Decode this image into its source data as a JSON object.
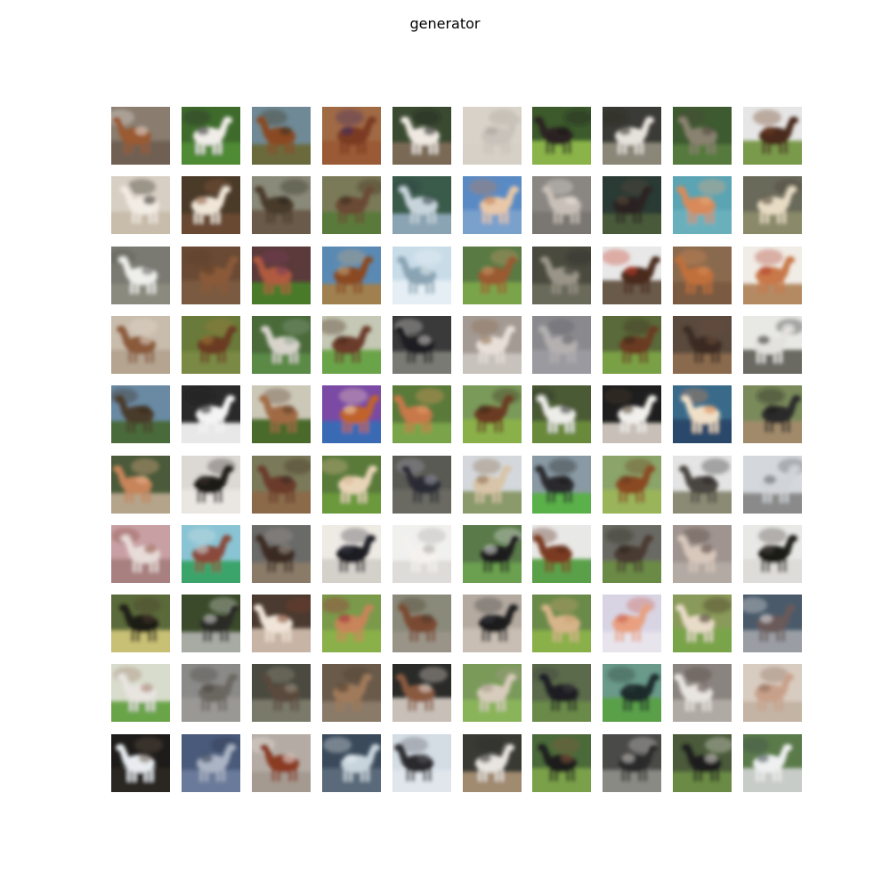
{
  "title": "generator",
  "grid": {
    "rows": 10,
    "cols": 10,
    "subject": "horse"
  },
  "tiles": [
    {
      "bg": "#8a7d70",
      "ground": "#6f6153",
      "body": "#9a5a32",
      "accent": "#e8e2da"
    },
    {
      "bg": "#3e6b2c",
      "ground": "#4f8a34",
      "body": "#f0ede8",
      "accent": "#2a2a2a"
    },
    {
      "bg": "#6f8a96",
      "ground": "#6b6a3c",
      "body": "#8a4a24",
      "accent": "#3c3023"
    },
    {
      "bg": "#a06a45",
      "ground": "#9a5a35",
      "body": "#7a3a20",
      "accent": "#3a2a66"
    },
    {
      "bg": "#3a4a30",
      "ground": "#7a6a55",
      "body": "#efe9e2",
      "accent": "#1c1c1c"
    },
    {
      "bg": "#d8d2c8",
      "ground": "#d6d0c6",
      "body": "#c8c2ba",
      "accent": "#a8a29a"
    },
    {
      "bg": "#3c5a2c",
      "ground": "#8ab44a",
      "body": "#2a2420",
      "accent": "#1a1a1a"
    },
    {
      "bg": "#3a3a36",
      "ground": "#8a8678",
      "body": "#e6e2dc",
      "accent": "#2a2622"
    },
    {
      "bg": "#3e5a30",
      "ground": "#567a3c",
      "body": "#8a8270",
      "accent": "#4a463c"
    },
    {
      "bg": "#e6e6e6",
      "ground": "#7a9a4c",
      "body": "#4a2a1a",
      "accent": "#6a3a20"
    },
    {
      "bg": "#d8cfc4",
      "ground": "#c8bcaa",
      "body": "#f2ece4",
      "accent": "#2a2420"
    },
    {
      "bg": "#4a3a28",
      "ground": "#6a4a30",
      "body": "#f0e6d8",
      "accent": "#8a5a3a"
    },
    {
      "bg": "#8a8a7a",
      "ground": "#6a5a4a",
      "body": "#4a3a2c",
      "accent": "#2a241e"
    },
    {
      "bg": "#7a7a58",
      "ground": "#5a7a3a",
      "body": "#6a4a34",
      "accent": "#3a2a1e"
    },
    {
      "bg": "#3a5a4a",
      "ground": "#8aa4b4",
      "body": "#c8d4dc",
      "accent": "#2a3a44"
    },
    {
      "bg": "#5a8ac4",
      "ground": "#7aa0cc",
      "body": "#e8c8a8",
      "accent": "#c07a50"
    },
    {
      "bg": "#8a8682",
      "ground": "#7a7672",
      "body": "#c8c0b8",
      "accent": "#e8e2dc"
    },
    {
      "bg": "#2a3a34",
      "ground": "#4a5a3a",
      "body": "#2a2420",
      "accent": "#5a4a3a"
    },
    {
      "bg": "#5aa4b4",
      "ground": "#6ab0bc",
      "body": "#d88a5a",
      "accent": "#e8a878"
    },
    {
      "bg": "#6a6a5a",
      "ground": "#8a8a6a",
      "body": "#e8dcc4",
      "accent": "#4a3e30"
    },
    {
      "bg": "#7a7a72",
      "ground": "#8a8a7e",
      "body": "#eeeeea",
      "accent": "#5a5a56"
    },
    {
      "bg": "#6a4a34",
      "ground": "#7a5a40",
      "body": "#8a5a38",
      "accent": "#5a3a24"
    },
    {
      "bg": "#5a3a3a",
      "ground": "#4a7a2c",
      "body": "#b05a40",
      "accent": "#7a3a5a"
    },
    {
      "bg": "#5a8ab4",
      "ground": "#a08050",
      "body": "#8a4a24",
      "accent": "#c8a87a"
    },
    {
      "bg": "#c8dce8",
      "ground": "#e4eef4",
      "body": "#8aa4b4",
      "accent": "#eaf2f6"
    },
    {
      "bg": "#5a7a44",
      "ground": "#7aa448",
      "body": "#9a5a30",
      "accent": "#c89a6a"
    },
    {
      "bg": "#4a4a3e",
      "ground": "#6a6a5a",
      "body": "#9a9488",
      "accent": "#2a2a24"
    },
    {
      "bg": "#e8e8e8",
      "ground": "#6a5a4a",
      "body": "#4a2a1e",
      "accent": "#c83a2a"
    },
    {
      "bg": "#8a6a4e",
      "ground": "#7a5a40",
      "body": "#c0703a",
      "accent": "#d88a54"
    },
    {
      "bg": "#f0ece6",
      "ground": "#b48a64",
      "body": "#c8784a",
      "accent": "#b03a2a"
    },
    {
      "bg": "#c8bcac",
      "ground": "#b4a490",
      "body": "#8a5a3a",
      "accent": "#e8ddd0"
    },
    {
      "bg": "#6a7a3a",
      "ground": "#7a8a44",
      "body": "#6a3a20",
      "accent": "#a07a3a"
    },
    {
      "bg": "#4a6a3a",
      "ground": "#5a8a44",
      "body": "#d8d4cc",
      "accent": "#8aa08a"
    },
    {
      "bg": "#c4c8b4",
      "ground": "#6aa44a",
      "body": "#6a3a2a",
      "accent": "#4a2a1e"
    },
    {
      "bg": "#3a3a3a",
      "ground": "#7a7a74",
      "body": "#1e1e22",
      "accent": "#d8d4d0"
    },
    {
      "bg": "#a49a94",
      "ground": "#c8c2bc",
      "body": "#e8e0d8",
      "accent": "#8a6a4a"
    },
    {
      "bg": "#8a8a8e",
      "ground": "#9a9aa0",
      "body": "#b4b0b0",
      "accent": "#5a5a60"
    },
    {
      "bg": "#5a6a3a",
      "ground": "#7aa044",
      "body": "#6a3a20",
      "accent": "#3a2a1a"
    },
    {
      "bg": "#5a4a3e",
      "ground": "#8a6a4e",
      "body": "#3a2a22",
      "accent": "#6a4a3a"
    },
    {
      "bg": "#e8e8e4",
      "ground": "#6a6a64",
      "body": "#e4e2de",
      "accent": "#2a2a28"
    },
    {
      "bg": "#6a8aa4",
      "ground": "#4a6a3a",
      "body": "#4a3a2a",
      "accent": "#3a2a1e"
    },
    {
      "bg": "#2a2a2a",
      "ground": "#e8e8e8",
      "body": "#f4f4f4",
      "accent": "#1a1a1a"
    },
    {
      "bg": "#ccc8b8",
      "ground": "#4a6a2a",
      "body": "#a06a44",
      "accent": "#5a3a24"
    },
    {
      "bg": "#7a4aa4",
      "ground": "#3a6ab4",
      "body": "#c0642a",
      "accent": "#f0d8c0"
    },
    {
      "bg": "#5a7a3a",
      "ground": "#7aa448",
      "body": "#c8784a",
      "accent": "#e49a64"
    },
    {
      "bg": "#7a9a5a",
      "ground": "#8ab04a",
      "body": "#6a3a20",
      "accent": "#3a2a1a"
    },
    {
      "bg": "#4a5a34",
      "ground": "#6a8a3a",
      "body": "#ecece8",
      "accent": "#2a2a24"
    },
    {
      "bg": "#1e1e1e",
      "ground": "#c8c0b8",
      "body": "#f2f0ec",
      "accent": "#4a3a2a"
    },
    {
      "bg": "#3a6a8a",
      "ground": "#2a4a6a",
      "body": "#f0e0c8",
      "accent": "#d8844a"
    },
    {
      "bg": "#7a8a5a",
      "ground": "#a08a6a",
      "body": "#2a2a2a",
      "accent": "#1a1a1a"
    },
    {
      "bg": "#4a5a3a",
      "ground": "#b4a48a",
      "body": "#c8845a",
      "accent": "#e8b08a"
    },
    {
      "bg": "#dcd8d4",
      "ground": "#eae6e2",
      "body": "#1e1a18",
      "accent": "#3a3430"
    },
    {
      "bg": "#7a7a5a",
      "ground": "#8a6a4a",
      "body": "#6a3a2a",
      "accent": "#3a2a22"
    },
    {
      "bg": "#5a7a3a",
      "ground": "#6a9a3a",
      "body": "#e8d4b8",
      "accent": "#d8b490"
    },
    {
      "bg": "#5a5a54",
      "ground": "#6a6a64",
      "body": "#2a2a34",
      "accent": "#a4a4b4"
    },
    {
      "bg": "#d4d8dc",
      "ground": "#8a9a6a",
      "body": "#d8c4a8",
      "accent": "#8a6a4a"
    },
    {
      "bg": "#8a9aa4",
      "ground": "#5ab04a",
      "body": "#2a2a2e",
      "accent": "#1a1a1a"
    },
    {
      "bg": "#8aa46a",
      "ground": "#9ab45a",
      "body": "#8a4a24",
      "accent": "#6a3a20"
    },
    {
      "bg": "#e4e4e4",
      "ground": "#8a8a74",
      "body": "#4a4440",
      "accent": "#2a2624"
    },
    {
      "bg": "#d4d8dc",
      "ground": "#8a8a8a",
      "body": "#d0d4d8",
      "accent": "#5a5e64"
    },
    {
      "bg": "#c8a0a4",
      "ground": "#a88080",
      "body": "#e8dcd8",
      "accent": "#8a4a3a"
    },
    {
      "bg": "#8ac4d4",
      "ground": "#3aa46a",
      "body": "#8a4a3a",
      "accent": "#d4e0e4"
    },
    {
      "bg": "#6a6a68",
      "ground": "#8a7a68",
      "body": "#3a2a22",
      "accent": "#a49c94"
    },
    {
      "bg": "#eeeae4",
      "ground": "#d4d0ca",
      "body": "#1a1a24",
      "accent": "#3a3a44"
    },
    {
      "bg": "#f0f0ee",
      "ground": "#dedcd8",
      "body": "#f4f2ee",
      "accent": "#aaa6a0"
    },
    {
      "bg": "#5a7a4a",
      "ground": "#6aa050",
      "body": "#1e1e1e",
      "accent": "#ececec"
    },
    {
      "bg": "#e8e8e6",
      "ground": "#5aa04a",
      "body": "#7a3a20",
      "accent": "#5a2a18"
    },
    {
      "bg": "#6a6a64",
      "ground": "#6a8a44",
      "body": "#4a3a30",
      "accent": "#2a2420"
    },
    {
      "bg": "#a09490",
      "ground": "#b4aaa4",
      "body": "#d8c8bc",
      "accent": "#4a3a34"
    },
    {
      "bg": "#e8e8e6",
      "ground": "#dedcd8",
      "body": "#1e1a18",
      "accent": "#4a4440"
    },
    {
      "bg": "#5a6a3a",
      "ground": "#c8c074",
      "body": "#1e1a18",
      "accent": "#4a3a2a"
    },
    {
      "bg": "#3a4a2a",
      "ground": "#a8aaa4",
      "body": "#2a2a28",
      "accent": "#dcdcd8"
    },
    {
      "bg": "#4a3a30",
      "ground": "#c8b4a4",
      "body": "#f0e4d8",
      "accent": "#7a3a24"
    },
    {
      "bg": "#7a9a4a",
      "ground": "#8ab04a",
      "body": "#c8845a",
      "accent": "#a02a3a"
    },
    {
      "bg": "#8a8a7a",
      "ground": "#9a9488",
      "body": "#7a4a30",
      "accent": "#4a3a2e"
    },
    {
      "bg": "#b4aaa0",
      "ground": "#c8beb4",
      "body": "#1a1a1e",
      "accent": "#3a3a40"
    },
    {
      "bg": "#6a8a4a",
      "ground": "#8ab04a",
      "body": "#d8b48a",
      "accent": "#c8a070"
    },
    {
      "bg": "#d8d4e4",
      "ground": "#e8e4ec",
      "body": "#e8a080",
      "accent": "#c85a4a"
    },
    {
      "bg": "#8a9a5a",
      "ground": "#7aa448",
      "body": "#e8dcc8",
      "accent": "#3a2a1e"
    },
    {
      "bg": "#4a5a6a",
      "ground": "#9a9ea4",
      "body": "#6a5a5a",
      "accent": "#e4e4e8"
    },
    {
      "bg": "#d8dccc",
      "ground": "#6aa44a",
      "body": "#e8e4e0",
      "accent": "#a07a6a"
    },
    {
      "bg": "#8a8a88",
      "ground": "#9a9894",
      "body": "#6a6660",
      "accent": "#4a4640"
    },
    {
      "bg": "#4a4a40",
      "ground": "#7a7a6a",
      "body": "#5a4a3e",
      "accent": "#9a9484"
    },
    {
      "bg": "#6a5a4a",
      "ground": "#8a7a68",
      "body": "#a07a5a",
      "accent": "#4a3a2e"
    },
    {
      "bg": "#2a2a28",
      "ground": "#c8c0b8",
      "body": "#8a5a40",
      "accent": "#e8e0d8"
    },
    {
      "bg": "#7a9a5a",
      "ground": "#8ab45a",
      "body": "#d8ccbc",
      "accent": "#a4988a"
    },
    {
      "bg": "#5a6a4a",
      "ground": "#6a8a4a",
      "body": "#1e1e22",
      "accent": "#3a3a3e"
    },
    {
      "bg": "#6a9a8a",
      "ground": "#5aa04a",
      "body": "#1e2a2a",
      "accent": "#2a3a34"
    },
    {
      "bg": "#8a8480",
      "ground": "#b0aaa4",
      "body": "#e8e4e0",
      "accent": "#4a3a34"
    },
    {
      "bg": "#d8ccc0",
      "ground": "#c4b4a4",
      "body": "#c8a08a",
      "accent": "#8a6a5a"
    },
    {
      "bg": "#1e1c1a",
      "ground": "#2a2624",
      "body": "#e8ecf0",
      "accent": "#6a5a4a"
    },
    {
      "bg": "#4a5a7a",
      "ground": "#6a7a9a",
      "body": "#aab4c4",
      "accent": "#2a3448"
    },
    {
      "bg": "#b4aca4",
      "ground": "#a49a90",
      "body": "#8a3a24",
      "accent": "#f0e8e0"
    },
    {
      "bg": "#3a4a5a",
      "ground": "#5a6a7a",
      "body": "#c8d4dc",
      "accent": "#e8eef2"
    },
    {
      "bg": "#d4dce4",
      "ground": "#e0e6ec",
      "body": "#2a2a2e",
      "accent": "#5a5a60"
    },
    {
      "bg": "#3a3a34",
      "ground": "#a08a70",
      "body": "#e8e4e0",
      "accent": "#2a2a28"
    },
    {
      "bg": "#4a6a3a",
      "ground": "#7aa04a",
      "body": "#1e1e1e",
      "accent": "#8a5a3a"
    },
    {
      "bg": "#4a4a48",
      "ground": "#8a8a84",
      "body": "#2a2a2a",
      "accent": "#d8d4d0"
    },
    {
      "bg": "#4a5a3a",
      "ground": "#6a8a44",
      "body": "#1e1e1a",
      "accent": "#e8e4dc"
    },
    {
      "bg": "#5a7a4a",
      "ground": "#c8ccc8",
      "body": "#eef0f0",
      "accent": "#3a4a4a"
    }
  ]
}
